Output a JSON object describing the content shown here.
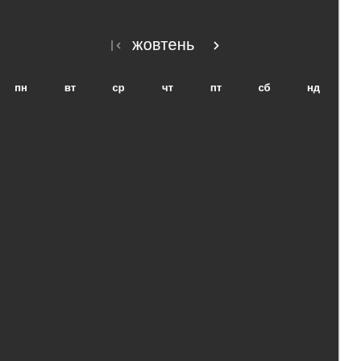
{
  "calendar": {
    "month": "жовтень",
    "nav": {
      "first_icon": "first-page-icon",
      "prev_icon": "chevron-left-icon",
      "next_icon": "chevron-right-icon"
    },
    "weekdays": [
      "пн",
      "вт",
      "ср",
      "чт",
      "пт",
      "сб",
      "нд"
    ]
  },
  "colors": {
    "background": "#2e2e2e",
    "text": "#ffffff",
    "muted_icon": "#9a9a9a"
  }
}
